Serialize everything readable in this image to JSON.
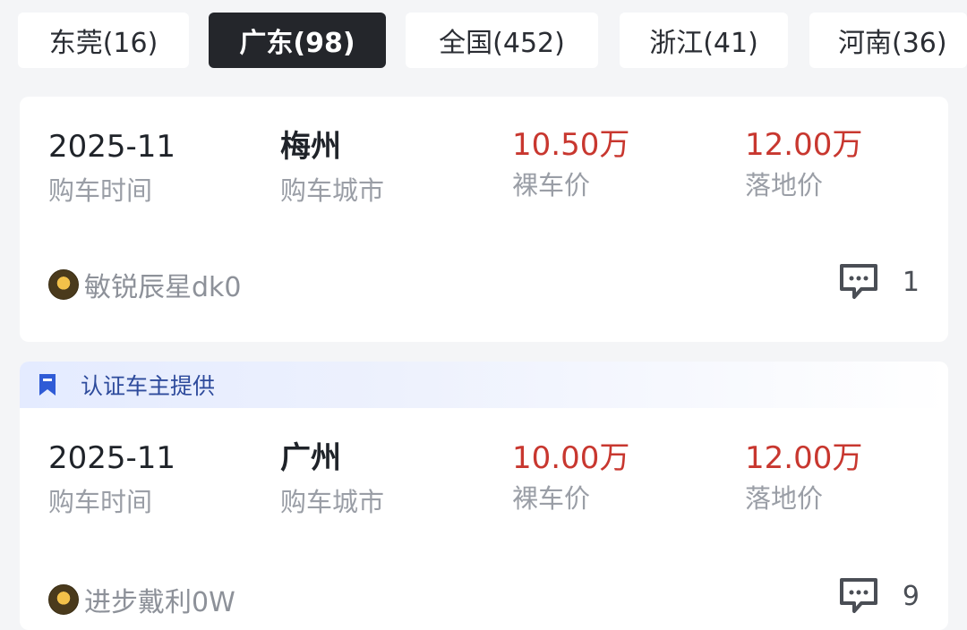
{
  "filter_tabs": [
    {
      "label": "东莞(16)",
      "active": false
    },
    {
      "label": "广东(98)",
      "active": true
    },
    {
      "label": "全国(452)",
      "active": false
    },
    {
      "label": "浙江(41)",
      "active": false
    },
    {
      "label": "河南(36)",
      "active": false
    }
  ],
  "colors": {
    "price": "#c8372f",
    "active_tab_bg": "#24262b",
    "banner_text": "#2e4b9c",
    "label_gray": "#9a9ea6"
  },
  "records": [
    {
      "badge": null,
      "purchase_time": "2025-11",
      "purchase_time_label": "购车时间",
      "city": "梅州",
      "city_label": "购车城市",
      "bare_price": "10.50万",
      "bare_price_label": "裸车价",
      "landed_price": "12.00万",
      "landed_price_label": "落地价",
      "user": "敏锐辰星dk0",
      "avatar_icon": "tiger-avatar",
      "comment_icon": "comment-bubble-icon",
      "comment_count": "1"
    },
    {
      "badge": "认证车主提供",
      "badge_icon": "bookmark-icon",
      "purchase_time": "2025-11",
      "purchase_time_label": "购车时间",
      "city": "广州",
      "city_label": "购车城市",
      "bare_price": "10.00万",
      "bare_price_label": "裸车价",
      "landed_price": "12.00万",
      "landed_price_label": "落地价",
      "user": "进步戴利0W",
      "avatar_icon": "tiger-avatar",
      "comment_icon": "comment-bubble-icon",
      "comment_count": "9"
    }
  ]
}
